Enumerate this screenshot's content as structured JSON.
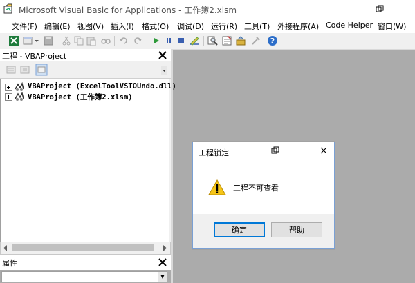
{
  "window": {
    "title": "Microsoft Visual Basic for Applications - 工作簿2.xlsm"
  },
  "menu": [
    {
      "label": "文件(F)"
    },
    {
      "label": "编辑(E)"
    },
    {
      "label": "视图(V)"
    },
    {
      "label": "插入(I)"
    },
    {
      "label": "格式(O)"
    },
    {
      "label": "调试(D)"
    },
    {
      "label": "运行(R)"
    },
    {
      "label": "工具(T)"
    },
    {
      "label": "外接程序(A)"
    },
    {
      "label": "Code Helper"
    },
    {
      "label": "窗口(W)"
    }
  ],
  "toolbar": {
    "icons": [
      "excel-icon",
      "insert-userform-icon",
      "save-icon",
      "cut-icon",
      "copy-icon",
      "paste-icon",
      "find-icon",
      "undo-icon",
      "redo-icon",
      "run-icon",
      "break-icon",
      "reset-icon",
      "design-mode-icon",
      "project-explorer-icon",
      "properties-window-icon",
      "object-browser-icon",
      "toolbox-icon",
      "help-icon"
    ]
  },
  "project_pane": {
    "title": "工程 - VBAProject",
    "tree": [
      {
        "label": "VBAProject (ExcelToolVSTOUndo.dll)"
      },
      {
        "label": "VBAProject (工作簿2.xlsm)"
      }
    ]
  },
  "properties_pane": {
    "title": "属性"
  },
  "dialog": {
    "title": "工程锁定",
    "message": "工程不可查看",
    "ok_label": "确定",
    "help_label": "帮助"
  }
}
